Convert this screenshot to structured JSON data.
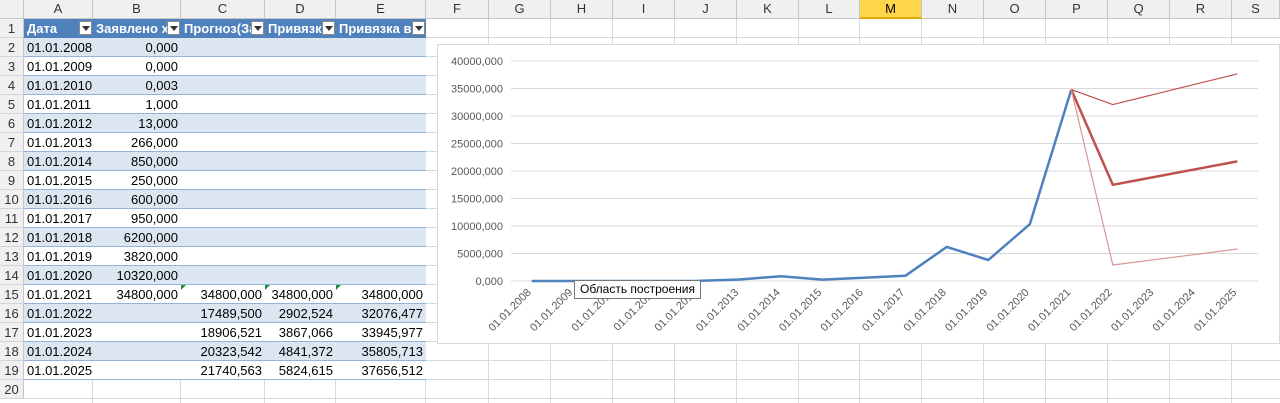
{
  "sheet": {
    "columns": [
      "A",
      "B",
      "C",
      "D",
      "E",
      "F",
      "G",
      "H",
      "I",
      "J",
      "K",
      "L",
      "M",
      "N",
      "O",
      "P",
      "Q",
      "R",
      "S"
    ],
    "selected_column": "M",
    "rows": [
      "1",
      "2",
      "3",
      "4",
      "5",
      "6",
      "7",
      "8",
      "9",
      "10",
      "11",
      "12",
      "13",
      "14",
      "15",
      "16",
      "17",
      "18",
      "19",
      "20"
    ],
    "headers": [
      "Дата",
      "Заявлено х",
      "Прогноз(За",
      "Привязк",
      "Привязка вь"
    ],
    "data": [
      [
        "01.01.2008",
        "0,000",
        "",
        "",
        ""
      ],
      [
        "01.01.2009",
        "0,000",
        "",
        "",
        ""
      ],
      [
        "01.01.2010",
        "0,003",
        "",
        "",
        ""
      ],
      [
        "01.01.2011",
        "1,000",
        "",
        "",
        ""
      ],
      [
        "01.01.2012",
        "13,000",
        "",
        "",
        ""
      ],
      [
        "01.01.2013",
        "266,000",
        "",
        "",
        ""
      ],
      [
        "01.01.2014",
        "850,000",
        "",
        "",
        ""
      ],
      [
        "01.01.2015",
        "250,000",
        "",
        "",
        ""
      ],
      [
        "01.01.2016",
        "600,000",
        "",
        "",
        ""
      ],
      [
        "01.01.2017",
        "950,000",
        "",
        "",
        ""
      ],
      [
        "01.01.2018",
        "6200,000",
        "",
        "",
        ""
      ],
      [
        "01.01.2019",
        "3820,000",
        "",
        "",
        ""
      ],
      [
        "01.01.2020",
        "10320,000",
        "",
        "",
        ""
      ],
      [
        "01.01.2021",
        "34800,000",
        "34800,000",
        "34800,000",
        "34800,000"
      ],
      [
        "01.01.2022",
        "",
        "17489,500",
        "2902,524",
        "32076,477"
      ],
      [
        "01.01.2023",
        "",
        "18906,521",
        "3867,066",
        "33945,977"
      ],
      [
        "01.01.2024",
        "",
        "20323,542",
        "4841,372",
        "35805,713"
      ],
      [
        "01.01.2025",
        "",
        "21740,563",
        "5824,615",
        "37656,512"
      ]
    ]
  },
  "tooltip": "Область построения",
  "chart_data": {
    "type": "line",
    "categories": [
      "01.01.2008",
      "01.01.2009",
      "01.01.2010",
      "01.01.2011",
      "01.01.2012",
      "01.01.2013",
      "01.01.2014",
      "01.01.2015",
      "01.01.2016",
      "01.01.2017",
      "01.01.2018",
      "01.01.2019",
      "01.01.2020",
      "01.01.2021",
      "01.01.2022",
      "01.01.2023",
      "01.01.2024",
      "01.01.2025"
    ],
    "ylim": [
      0,
      40000
    ],
    "yticks": [
      "0,000",
      "5000,000",
      "10000,000",
      "15000,000",
      "20000,000",
      "25000,000",
      "30000,000",
      "35000,000",
      "40000,000"
    ],
    "grid": true,
    "series": [
      {
        "values": [
          0,
          0,
          0.003,
          1,
          13,
          266,
          850,
          250,
          600,
          950,
          6200,
          3820,
          10320,
          34800,
          null,
          null,
          null,
          null
        ],
        "color": "#4f81bd",
        "width": 2.5
      },
      {
        "values": [
          null,
          null,
          null,
          null,
          null,
          null,
          null,
          null,
          null,
          null,
          null,
          null,
          null,
          34800,
          17489.5,
          18906.521,
          20323.542,
          21740.563
        ],
        "color": "#c0504d",
        "width": 2.5
      },
      {
        "values": [
          null,
          null,
          null,
          null,
          null,
          null,
          null,
          null,
          null,
          null,
          null,
          null,
          null,
          34800,
          2902.524,
          3867.066,
          4841.372,
          5824.615
        ],
        "color": "#d99694",
        "width": 1.2
      },
      {
        "values": [
          null,
          null,
          null,
          null,
          null,
          null,
          null,
          null,
          null,
          null,
          null,
          null,
          null,
          34800,
          32076.477,
          33945.977,
          35805.713,
          37656.512
        ],
        "color": "#c0504d",
        "width": 1.2
      }
    ]
  }
}
